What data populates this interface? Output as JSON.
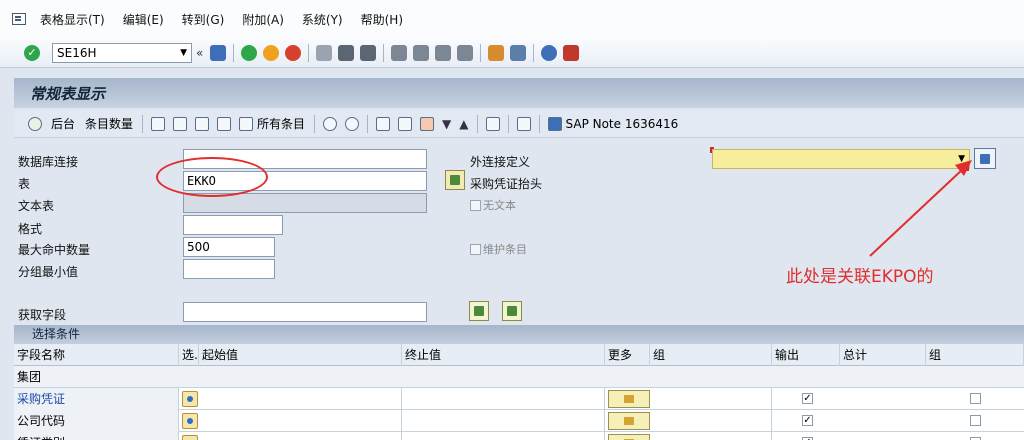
{
  "menubar": {
    "items": [
      "表格显示(T)",
      "编辑(E)",
      "转到(G)",
      "附加(A)",
      "系统(Y)",
      "帮助(H)"
    ]
  },
  "toolbar": {
    "command_field_value": "SE16H",
    "nav_symbol": "«"
  },
  "title": "常规表显示",
  "app_toolbar": {
    "back_label": "后台",
    "count_label": "条目数量",
    "all_entries_label": "所有条目",
    "sap_note": "SAP Note 1636416"
  },
  "form": {
    "db_connection_label": "数据库连接",
    "db_connection_value": "",
    "table_label": "表",
    "table_value": "EKKO",
    "table_description": "采购凭证抬头",
    "text_table_label": "文本表",
    "format_label": "格式",
    "format_value": "",
    "max_hits_label": "最大命中数量",
    "max_hits_value": "500",
    "group_min_label": "分组最小值",
    "group_min_value": "",
    "get_fields_label": "获取字段",
    "outer_join_label": "外连接定义",
    "no_text_label": "无文本",
    "maintain_entries_label": "维护条目"
  },
  "annotation": {
    "text": "此处是关联EKPO的"
  },
  "selection": {
    "title": "选择条件",
    "columns": [
      "字段名称",
      "选.",
      "起始值",
      "终止值",
      "更多",
      "组",
      "输出",
      "总计",
      "组"
    ],
    "rows": [
      {
        "name": "集团",
        "type": "group"
      },
      {
        "name": "采购凭证",
        "type": "field",
        "output_checked": "✓"
      },
      {
        "name": "公司代码",
        "type": "field",
        "output_checked": "✓"
      },
      {
        "name": "凭证类别",
        "type": "field",
        "output_checked": "✓"
      }
    ]
  },
  "colors": {
    "annotation_red": "#e02d2d",
    "title_bar": "#a6b6cb",
    "field_link_blue": "#1b4aa8"
  }
}
